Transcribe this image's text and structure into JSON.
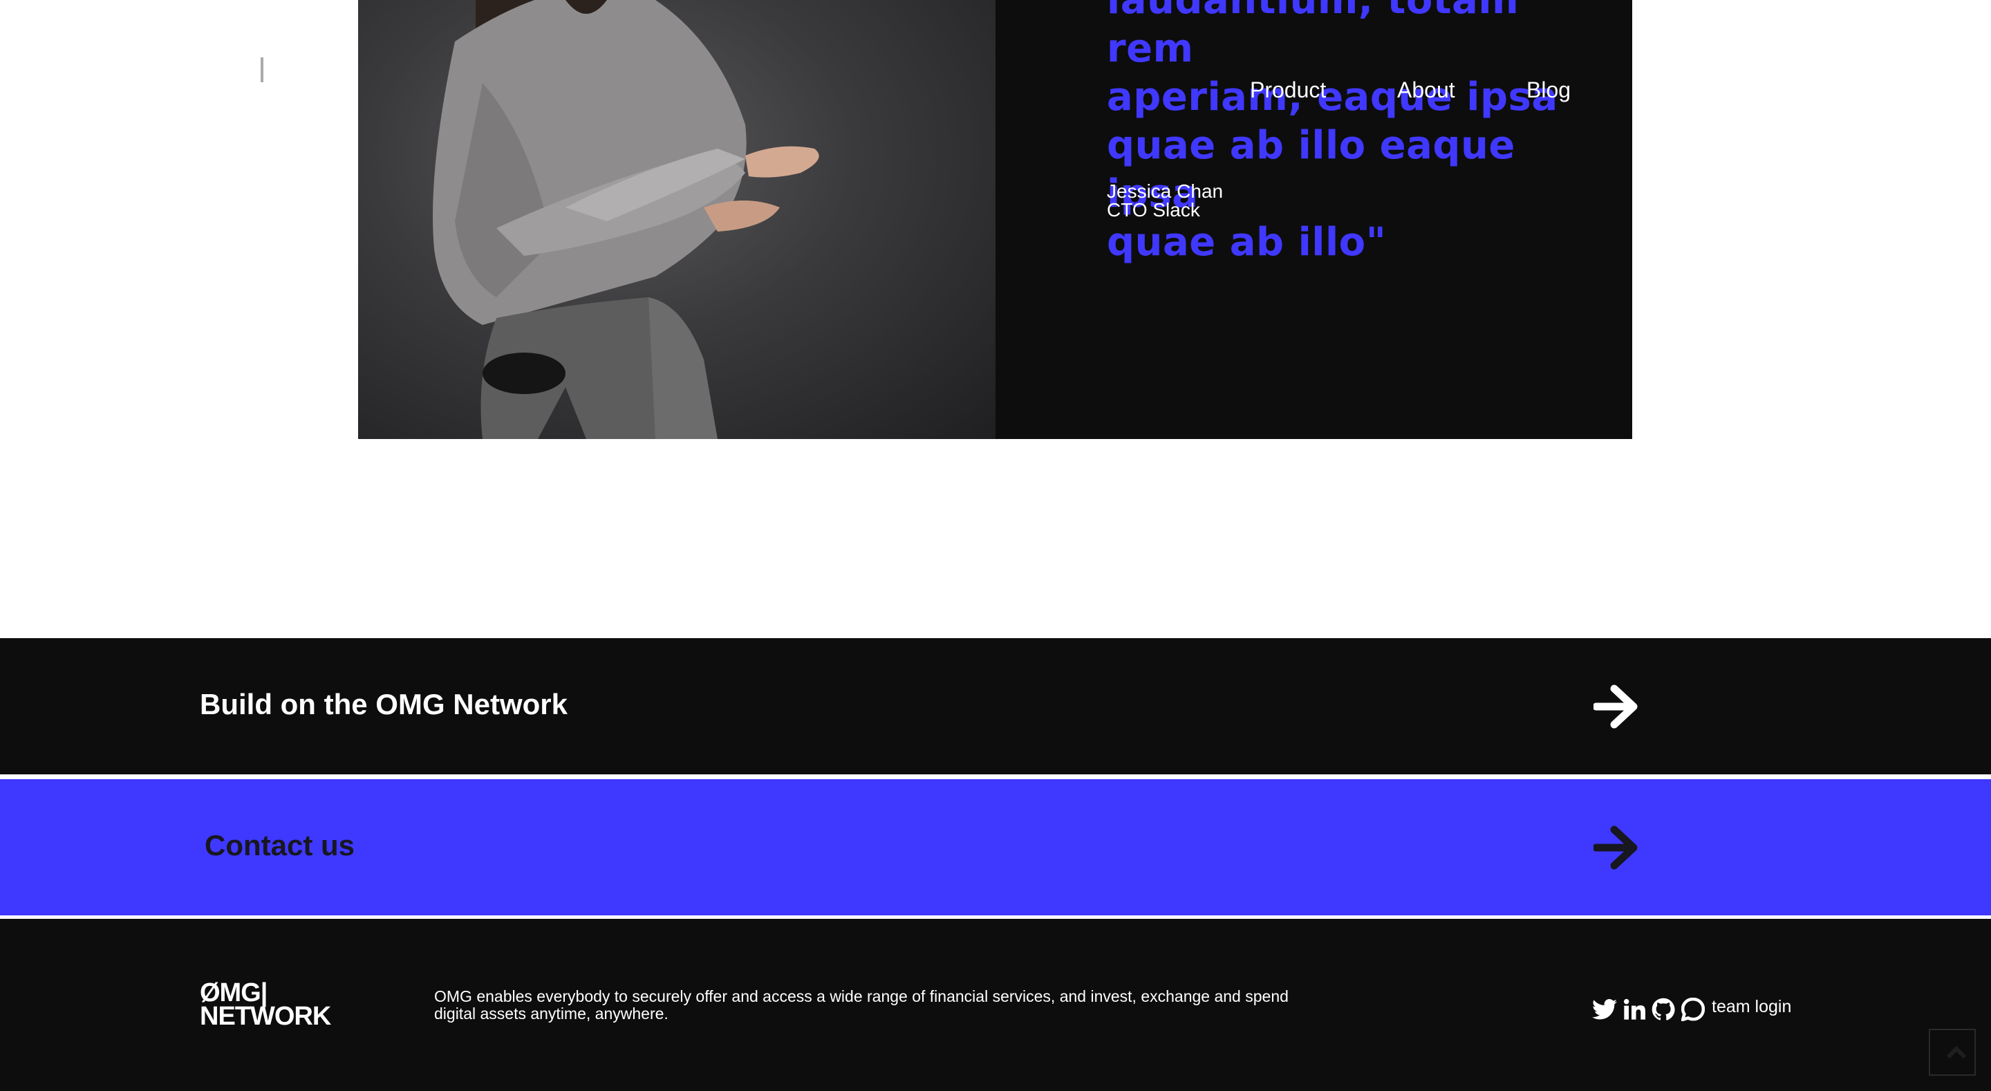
{
  "nav": {
    "items": [
      "Product",
      "About",
      "Blog"
    ]
  },
  "testimonial": {
    "quote_lines": [
      "laudantium, totam rem",
      "aperiam, eaque ipsa",
      "quae ab illo eaque ipsa",
      "quae ab illo\""
    ],
    "author_name": "Jessica Chan",
    "author_title": "CTO Slack"
  },
  "cta": {
    "build_label": "Build on the OMG Network",
    "contact_label": "Contact us"
  },
  "footer": {
    "logo_line1": "ØMG|",
    "logo_line2": "NETWORK",
    "description": "OMG enables everybody to securely offer and access a wide range of financial services, and invest, exchange and spend digital assets anytime, anywhere.",
    "team_login": "team login",
    "social_icons": [
      "twitter-icon",
      "linkedin-icon",
      "github-icon",
      "chat-icon"
    ]
  },
  "colors": {
    "accent": "#3f38ff",
    "dark": "#0d0d0d",
    "quote": "#4038ff"
  }
}
